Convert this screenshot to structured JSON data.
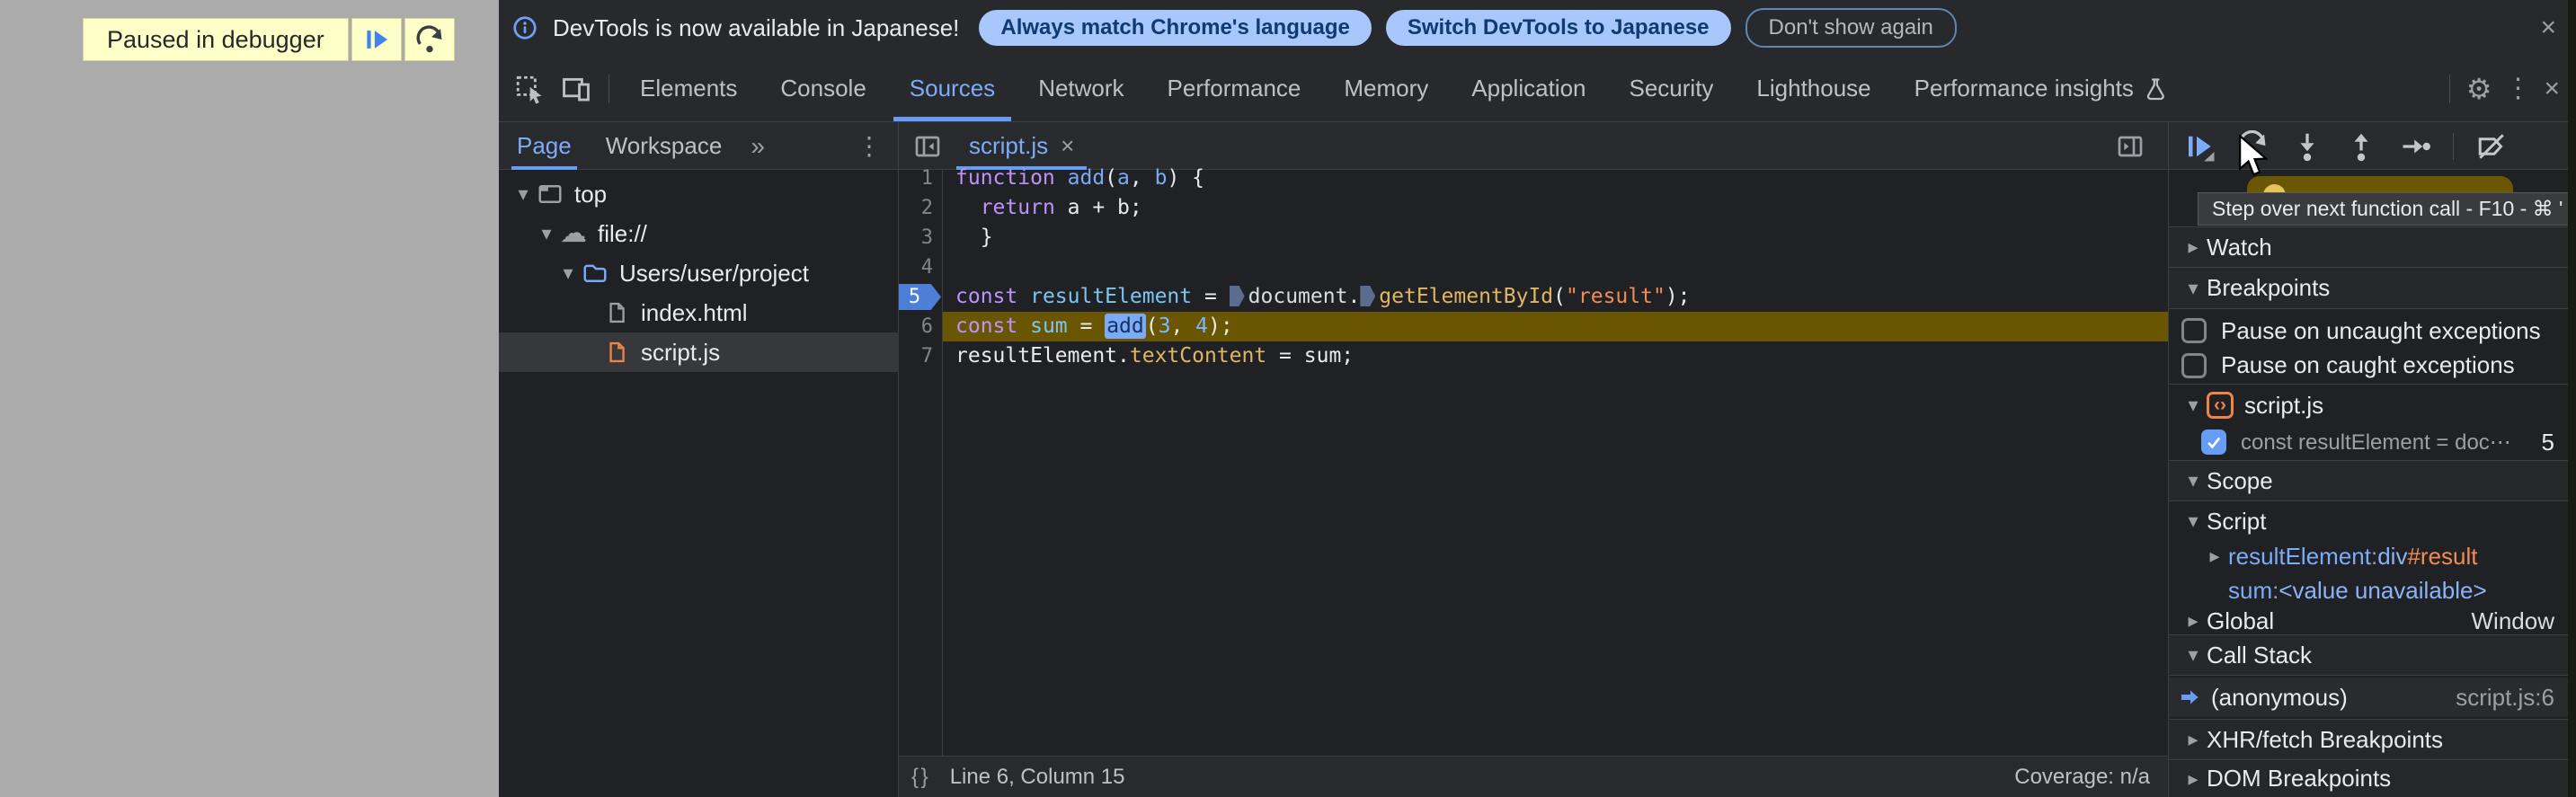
{
  "icons": {
    "gear": "⚙",
    "kebab": "⋮",
    "close": "×",
    "chevrons": "»",
    "caret_down": "▾",
    "caret_right": "▸",
    "cloud": "☁",
    "braces": "{ }",
    "code_badge": "‹›"
  },
  "page": {
    "paused_banner": "Paused in debugger"
  },
  "infobar": {
    "message": "DevTools is now available in Japanese!",
    "always_match": "Always match Chrome's language",
    "switch_jp": "Switch DevTools to Japanese",
    "dismiss": "Don't show again"
  },
  "tabs": {
    "elements": "Elements",
    "console": "Console",
    "sources": "Sources",
    "network": "Network",
    "performance": "Performance",
    "memory": "Memory",
    "application": "Application",
    "security": "Security",
    "lighthouse": "Lighthouse",
    "insights": "Performance insights"
  },
  "navigator": {
    "page_tab": "Page",
    "workspace_tab": "Workspace",
    "tree_top": "top",
    "tree_file": "file://",
    "tree_project": "Users/user/project",
    "tree_index": "index.html",
    "tree_script": "script.js"
  },
  "editor": {
    "file_tab": "script.js",
    "gutter": [
      "1",
      "2",
      "3",
      "4",
      "5",
      "6",
      "7"
    ],
    "code": [
      [
        "function ",
        "add",
        "(",
        "a",
        ", ",
        "b",
        ") {"
      ],
      [
        "  ",
        "return ",
        "a + b;"
      ],
      [
        "  }"
      ],
      [
        ""
      ],
      [
        "const ",
        "resultElement",
        " = ",
        "document",
        ".",
        "getElementById",
        "(",
        "\"result\"",
        ");"
      ],
      [
        "const ",
        "sum",
        " = ",
        "add",
        "(",
        "3",
        ", ",
        "4",
        ");"
      ],
      [
        "resultElement.",
        "textContent",
        " = sum;"
      ]
    ],
    "status_position": "Line 6, Column 15",
    "status_coverage": "Coverage: n/a"
  },
  "debugger": {
    "tooltip": "Step over next function call - F10 - ⌘ '",
    "watch": "Watch",
    "breakpoints": "Breakpoints",
    "pause_uncaught": "Pause on uncaught exceptions",
    "pause_caught": "Pause on caught exceptions",
    "bp_file": "script.js",
    "bp_entry": "const resultElement = doc⋯",
    "bp_line": "5",
    "scope": "Scope",
    "scope_script": "Script",
    "sep": ": ",
    "var1_name": "resultElement",
    "var1_tag": "div",
    "var1_id": "#result",
    "var2_name": "sum",
    "var2_value": "<value unavailable>",
    "global": "Global",
    "global_value": "Window",
    "callstack": "Call Stack",
    "frame": "(anonymous)",
    "frame_loc": "script.js:6",
    "xhr": "XHR/fetch Breakpoints",
    "dom": "DOM Breakpoints"
  }
}
